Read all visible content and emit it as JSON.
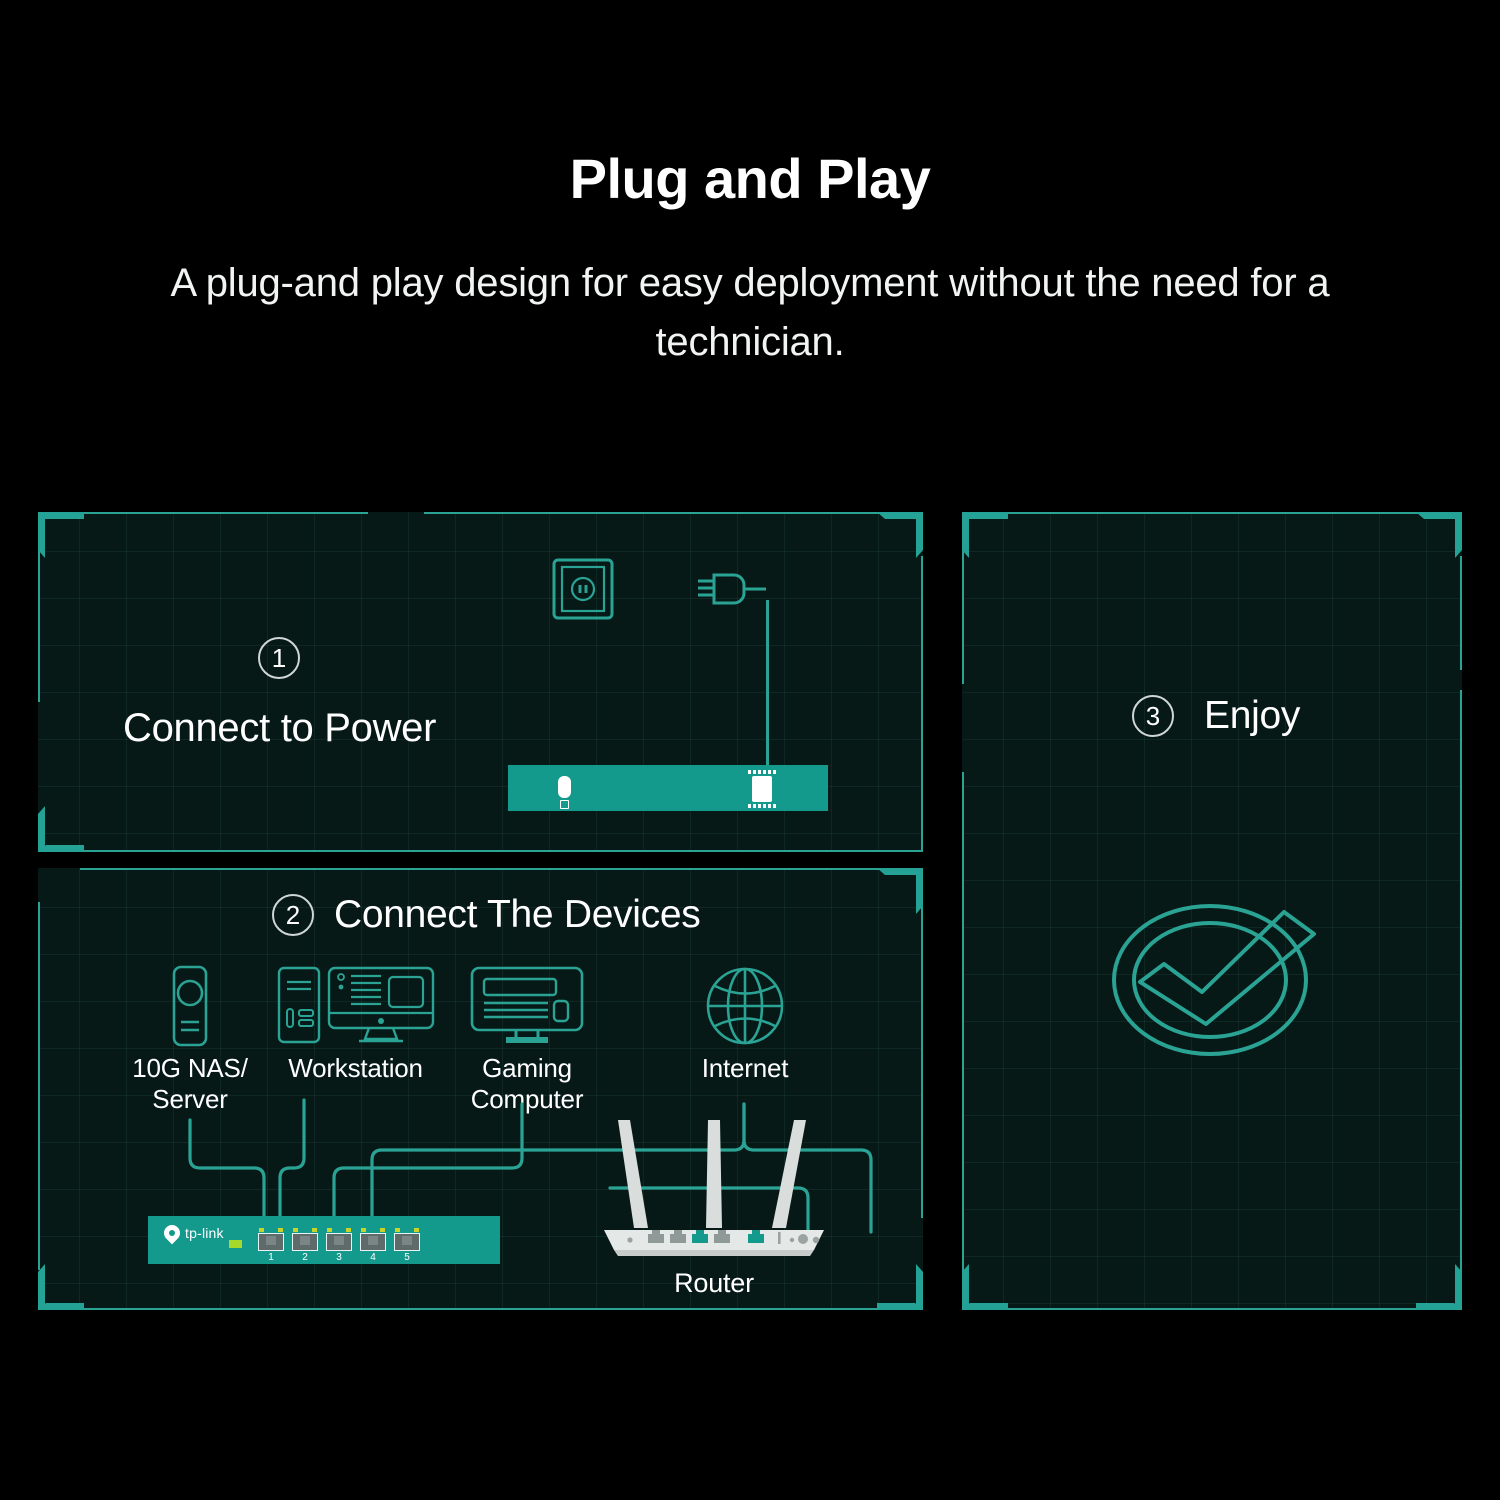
{
  "header": {
    "title": "Plug and Play",
    "subtitle": "A plug-and play design for easy deployment without the need for a technician."
  },
  "colors": {
    "background": "#000000",
    "panel_background": "#061916",
    "accent_teal": "#2aa394",
    "device_teal": "#149a8c",
    "text_white": "#ffffff",
    "led_green": "#a6d92b",
    "router_white": "#e2e6e6"
  },
  "steps": [
    {
      "number": "1",
      "label": "Connect to Power",
      "icons": [
        "wall-outlet-icon",
        "power-plug-icon",
        "switch-rear-icon"
      ]
    },
    {
      "number": "2",
      "label": "Connect The Devices",
      "devices": [
        {
          "name": "nas-server",
          "icon": "nas-server-icon",
          "caption_line1": "10G NAS/",
          "caption_line2": "Server"
        },
        {
          "name": "workstation",
          "icon": "workstation-icon",
          "caption_line1": "Workstation",
          "caption_line2": ""
        },
        {
          "name": "gaming-computer",
          "icon": "gaming-computer-icon",
          "caption_line1": "Gaming",
          "caption_line2": "Computer"
        },
        {
          "name": "internet",
          "icon": "globe-icon",
          "caption_line1": "Internet",
          "caption_line2": ""
        }
      ],
      "switch": {
        "brand": "tp-link",
        "ports": [
          "1",
          "2",
          "3",
          "4",
          "5"
        ]
      },
      "router": {
        "caption": "Router"
      }
    },
    {
      "number": "3",
      "label": "Enjoy",
      "icons": [
        "check-circle-icon"
      ]
    }
  ]
}
